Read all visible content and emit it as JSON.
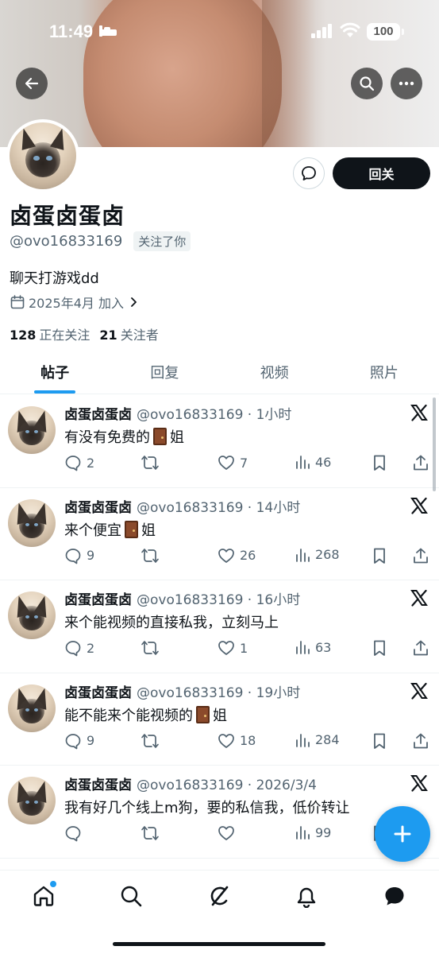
{
  "status_bar": {
    "time": "11:49",
    "battery": "100"
  },
  "profile": {
    "display_name": "卤蛋卤蛋卤",
    "handle": "@ovo16833169",
    "follows_you": "关注了你",
    "bio": "聊天打游戏dd",
    "joined": "2025年4月 加入",
    "following_count": "128",
    "following_label": "正在关注",
    "followers_count": "21",
    "followers_label": "关注者",
    "follow_back_label": "回关"
  },
  "tabs": [
    {
      "label": "帖子",
      "active": true
    },
    {
      "label": "回复",
      "active": false
    },
    {
      "label": "视频",
      "active": false
    },
    {
      "label": "照片",
      "active": false
    }
  ],
  "posts": [
    {
      "name": "卤蛋卤蛋卤",
      "meta": "@ovo16833169 · 1小时",
      "text_before": "有没有免费的",
      "has_door": true,
      "text_after": "姐",
      "replies": "2",
      "retweets": "",
      "likes": "7",
      "views": "46"
    },
    {
      "name": "卤蛋卤蛋卤",
      "meta": "@ovo16833169 · 14小时",
      "text_before": "来个便宜",
      "has_door": true,
      "text_after": "姐",
      "replies": "9",
      "retweets": "",
      "likes": "26",
      "views": "268"
    },
    {
      "name": "卤蛋卤蛋卤",
      "meta": "@ovo16833169 · 16小时",
      "text_before": "来个能视频的直接私我，立刻马上",
      "has_door": false,
      "text_after": "",
      "replies": "2",
      "retweets": "",
      "likes": "1",
      "views": "63"
    },
    {
      "name": "卤蛋卤蛋卤",
      "meta": "@ovo16833169 · 19小时",
      "text_before": "能不能来个能视频的",
      "has_door": true,
      "text_after": "姐",
      "replies": "9",
      "retweets": "",
      "likes": "18",
      "views": "284"
    },
    {
      "name": "卤蛋卤蛋卤",
      "meta": "@ovo16833169 · 2026/3/4",
      "text_before": "我有好几个线上m狗，要的私信我，低价转让",
      "has_door": false,
      "text_after": "",
      "replies": "",
      "retweets": "",
      "likes": "",
      "views": "99"
    }
  ],
  "icons": {
    "back": "arrow-left-icon",
    "search": "search-icon",
    "more": "more-icon",
    "message": "message-icon",
    "calendar": "calendar-icon",
    "reply": "reply-icon",
    "retweet": "retweet-icon",
    "like": "heart-icon",
    "views": "views-icon",
    "bookmark": "bookmark-icon",
    "share": "share-icon",
    "compose": "plus-icon",
    "nav": [
      "home-icon",
      "search-icon",
      "grok-icon",
      "notifications-icon",
      "messages-icon"
    ]
  },
  "colors": {
    "accent": "#1d9bf0",
    "text": "#0f1419",
    "muted": "#536471"
  }
}
